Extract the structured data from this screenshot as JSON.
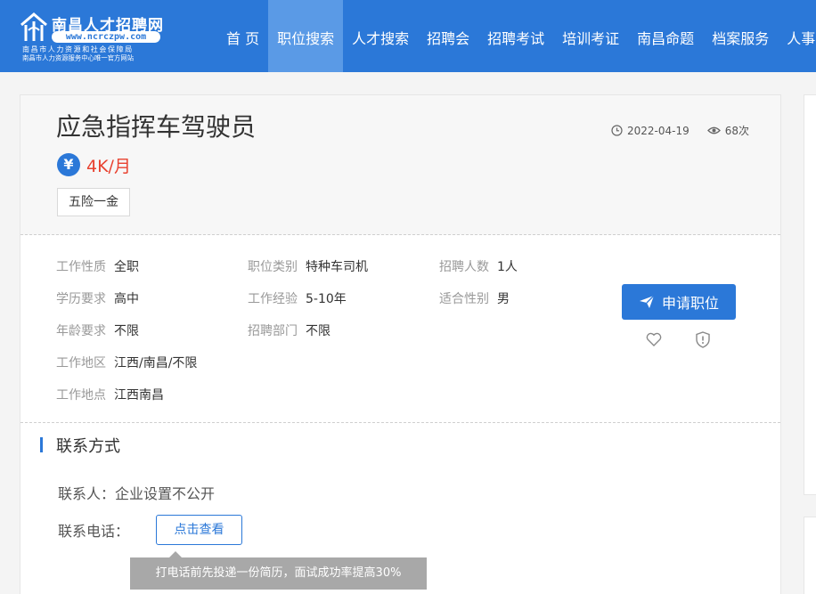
{
  "site": {
    "logo_title": "南昌人才招聘网",
    "logo_url": "www.ncrczpw.com",
    "logo_sub1": "南昌市人力资源和社会保障局",
    "logo_sub2": "南昌市人力资源服务中心唯一官方网站",
    "brand_color": "#2b78d8"
  },
  "nav": {
    "items": [
      {
        "label": "首 页"
      },
      {
        "label": "职位搜索",
        "active": true
      },
      {
        "label": "人才搜索"
      },
      {
        "label": "招聘会"
      },
      {
        "label": "招聘考试"
      },
      {
        "label": "培训考证"
      },
      {
        "label": "南昌命题"
      },
      {
        "label": "档案服务"
      },
      {
        "label": "人事"
      }
    ]
  },
  "job": {
    "title": "应急指挥车驾驶员",
    "salary_symbol": "¥",
    "salary": "4K/月",
    "salary_color": "#e8412f",
    "benefit_tag": "五险一金",
    "date": "2022-04-19",
    "views": "68次",
    "details": [
      {
        "label": "工作性质",
        "value": "全职"
      },
      {
        "label": "职位类别",
        "value": "特种车司机"
      },
      {
        "label": "招聘人数",
        "value": "1人"
      },
      {
        "label": "学历要求",
        "value": "高中"
      },
      {
        "label": "工作经验",
        "value": "5-10年"
      },
      {
        "label": "适合性别",
        "value": "男"
      },
      {
        "label": "年龄要求",
        "value": "不限"
      },
      {
        "label": "招聘部门",
        "value": "不限"
      },
      {
        "label": "工作地区",
        "value": "江西/南昌/不限"
      },
      {
        "label": "工作地点",
        "value": "江西南昌"
      }
    ],
    "apply_label": "申请职位"
  },
  "contact": {
    "section_title": "联系方式",
    "person_label": "联系人：",
    "person_value": "企业设置不公开",
    "phone_label": "联系电话：",
    "view_button": "点击查看",
    "tooltip": "打电话前先投递一份简历，面试成功率提高30%"
  }
}
